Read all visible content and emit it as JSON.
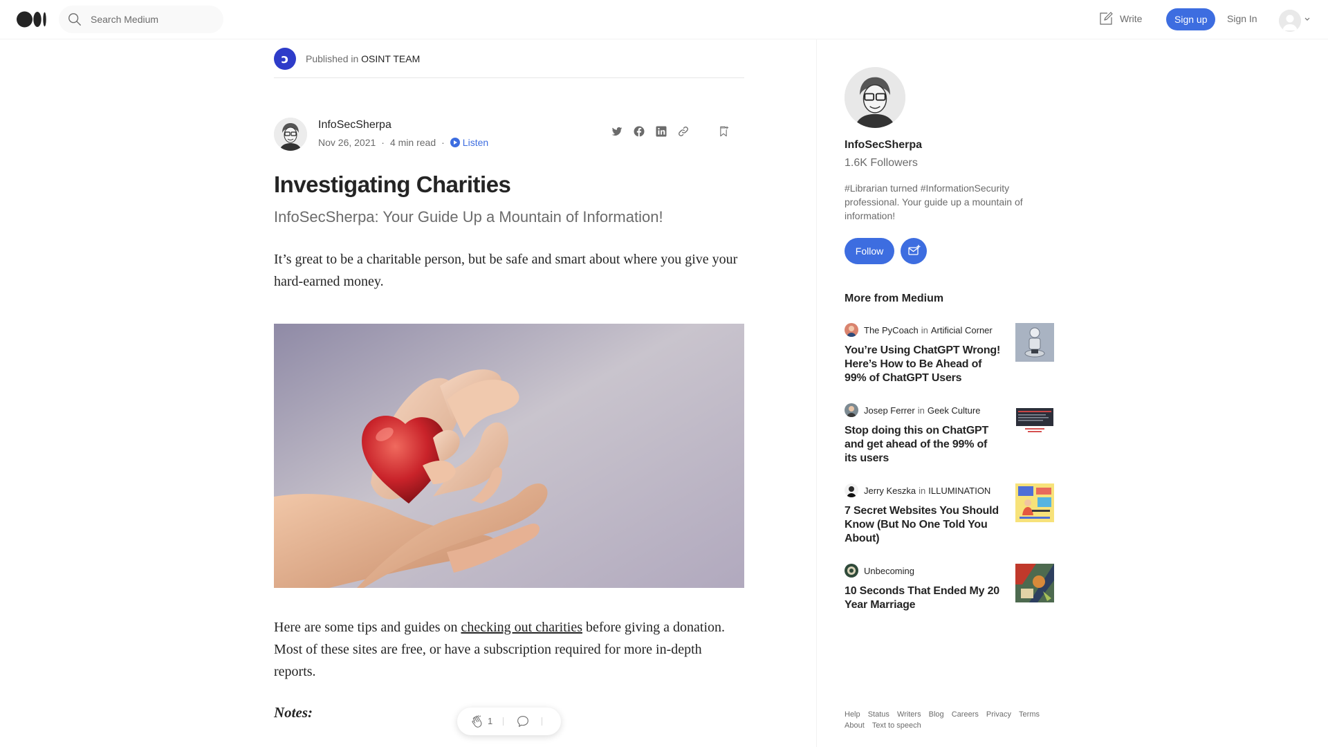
{
  "header": {
    "search_placeholder": "Search Medium",
    "write_label": "Write",
    "signup_label": "Sign up",
    "signin_label": "Sign In"
  },
  "publication": {
    "prefix": "Published in",
    "name": "OSINT TEAM"
  },
  "article": {
    "author": "InfoSecSherpa",
    "date": "Nov 26, 2021",
    "read_time": "4 min read",
    "listen_label": "Listen",
    "title": "Investigating Charities",
    "subtitle": "InfoSecSherpa: Your Guide Up a Mountain of Information!",
    "para1": "It’s great to be a charitable person, but be safe and smart about where you give your hard-earned money.",
    "para2_before": "Here are some tips and guides on ",
    "para2_link": "checking out charities",
    "para2_after": " before giving a donation. Most of these sites are free, or have a subscription required for more in-depth reports.",
    "notes_heading": "Notes:",
    "clap_count": "1"
  },
  "sidebar": {
    "name": "InfoSecSherpa",
    "followers": "1.6K Followers",
    "bio": "#Librarian turned #InformationSecurity professional. Your guide up a mountain of information!",
    "follow_label": "Follow",
    "more_heading": "More from Medium",
    "recommendations": [
      {
        "author": "The PyCoach",
        "in_label": "in",
        "publication": "Artificial Corner",
        "title": "You’re Using ChatGPT Wrong! Here’s How to Be Ahead of 99% of ChatGPT Users"
      },
      {
        "author": "Josep Ferrer",
        "in_label": "in",
        "publication": "Geek Culture",
        "title": "Stop doing this on ChatGPT and get ahead of the 99% of its users"
      },
      {
        "author": "Jerry Keszka",
        "in_label": "in",
        "publication": "ILLUMINATION",
        "title": "7 Secret Websites You Should Know (But No One Told You About)"
      },
      {
        "author": "Unbecoming",
        "in_label": "",
        "publication": "",
        "title": "10 Seconds That Ended My 20 Year Marriage"
      }
    ],
    "footer_links": [
      "Help",
      "Status",
      "Writers",
      "Blog",
      "Careers",
      "Privacy",
      "Terms",
      "About",
      "Text to speech"
    ]
  },
  "colors": {
    "accent": "#3d6de0",
    "text": "#242424",
    "muted": "#6b6b6b",
    "publication_logo": "#2e3cc9"
  },
  "icons": [
    "medium-logo-icon",
    "search-icon",
    "write-icon",
    "chevron-down-icon",
    "play-icon",
    "twitter-icon",
    "facebook-icon",
    "linkedin-icon",
    "link-icon",
    "bookmark-icon",
    "clap-icon",
    "response-icon",
    "mail-plus-icon"
  ]
}
